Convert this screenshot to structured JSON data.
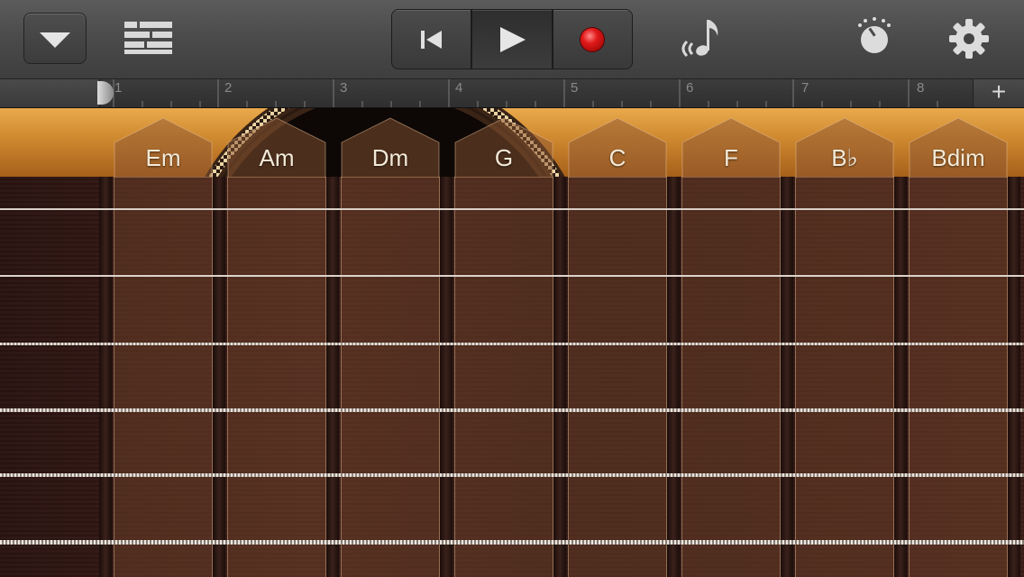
{
  "toolbar": {
    "dropdown_icon": "triangle-down-icon",
    "tracks_icon": "tracks-view-icon",
    "transport": {
      "rewind_icon": "skip-to-start-icon",
      "play_icon": "play-icon",
      "record_icon": "record-icon"
    },
    "smart_controls_icon": "musical-note-icon",
    "metronome_icon": "metronome-icon",
    "settings_icon": "gear-icon",
    "record_color": "#e21a1a"
  },
  "ruler": {
    "bars": [
      "1",
      "2",
      "3",
      "4",
      "5",
      "6",
      "7",
      "8"
    ],
    "add_label": "+"
  },
  "chords": [
    "Em",
    "Am",
    "Dm",
    "G",
    "C",
    "F",
    "B♭",
    "Bdim"
  ]
}
